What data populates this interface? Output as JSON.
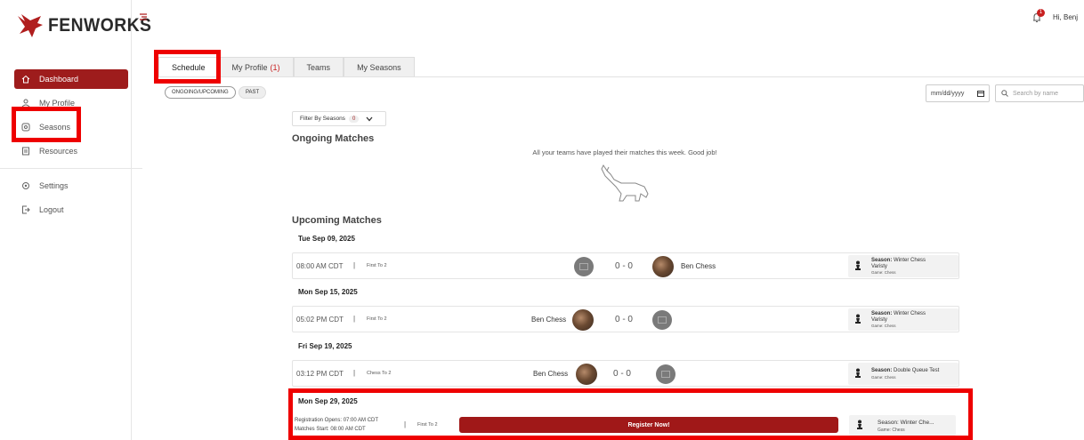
{
  "brand": {
    "name": "FENWORKS",
    "accent": "#9e1c1c"
  },
  "header": {
    "greeting": "Hi, Benj",
    "notification_count": "1"
  },
  "sidebar": {
    "items": [
      {
        "label": "Dashboard",
        "icon": "home-icon",
        "active": true
      },
      {
        "label": "My Profile",
        "icon": "profile-icon"
      },
      {
        "label": "Seasons",
        "icon": "seasons-icon"
      },
      {
        "label": "Resources",
        "icon": "resources-icon"
      },
      {
        "label": "Settings",
        "icon": "gear-icon"
      },
      {
        "label": "Logout",
        "icon": "logout-icon"
      }
    ]
  },
  "tabs": [
    {
      "label": "Schedule",
      "active": true
    },
    {
      "label": "My Profile",
      "count": "(1)"
    },
    {
      "label": "Teams"
    },
    {
      "label": "My Seasons"
    }
  ],
  "filters": {
    "ongoing_label": "ONGOING/UPCOMING",
    "past_label": "PAST",
    "date_value": "mm/dd/yyyy",
    "search_placeholder": "Search by name",
    "season_filter_label": "Filter By Seasons",
    "season_filter_count": "0"
  },
  "ongoing": {
    "title": "Ongoing Matches",
    "empty_message": "All your teams have played their matches this week. Good job!"
  },
  "upcoming": {
    "title": "Upcoming Matches",
    "days": [
      {
        "date": "Tue Sep 09, 2025",
        "time": "08:00 AM CDT",
        "format": "First To 2",
        "score": "0 - 0",
        "team": "Ben Chess",
        "season_label": "Season:",
        "season_name": "Winter Chess",
        "season_name2": "Varisty",
        "game": "Game: Chess"
      },
      {
        "date": "Mon Sep 15, 2025",
        "time": "05:02 PM CDT",
        "format": "First To 2",
        "score": "0 - 0",
        "team": "Ben Chess",
        "season_label": "Season:",
        "season_name": "Winter Chess",
        "season_name2": "Varisty",
        "game": "Game: Chess"
      },
      {
        "date": "Fri Sep 19, 2025",
        "time": "03:12 PM CDT",
        "format": "Chess To 2",
        "score": "0 - 0",
        "team": "Ben Chess",
        "season_label": "Season:",
        "season_name": "Double Queue Test",
        "game": "Game: Chess"
      }
    ],
    "registration": {
      "date": "Mon Sep 29, 2025",
      "opens": "Registration Opens: 07:00 AM CDT",
      "starts": "Matches Start: 08:00 AM CDT",
      "format": "First To 2",
      "button_label": "Register Now!",
      "season": "Season: Winter Che...",
      "game": "Game: Chess"
    }
  }
}
